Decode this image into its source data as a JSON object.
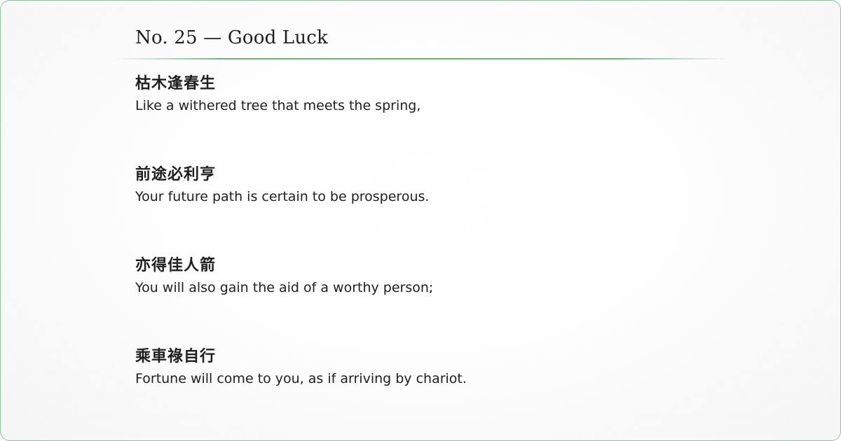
{
  "title": "No. 25 — Good Luck",
  "verses": [
    {
      "chinese": "枯木逢春生",
      "english": "Like a withered tree that meets the spring,"
    },
    {
      "chinese": "前途必利亨",
      "english": "Your future path is certain to be prosperous."
    },
    {
      "chinese": "亦得佳人箭",
      "english": "You will also gain the aid of a worthy person;"
    },
    {
      "chinese": "乘車祿自行",
      "english": "Fortune will come to you, as if arriving by chariot."
    }
  ],
  "colors": {
    "accent": "#63a870",
    "border": "#8cc49a",
    "text": "#1f1f1f"
  }
}
